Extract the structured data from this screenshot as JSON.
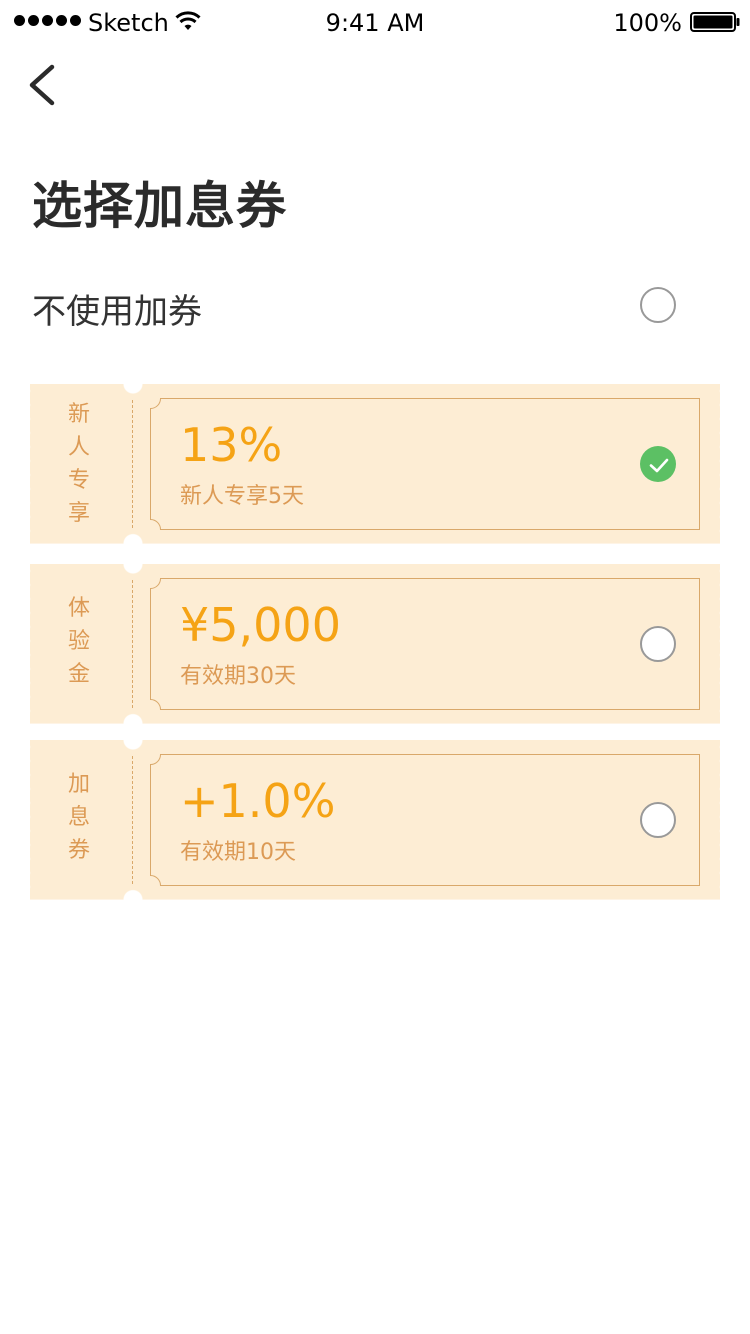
{
  "status_bar": {
    "carrier": "Sketch",
    "time": "9:41 AM",
    "battery": "100%"
  },
  "page": {
    "title": "选择加息券",
    "no_coupon_label": "不使用加券"
  },
  "coupons": [
    {
      "stub": "新人专享",
      "value": "13%",
      "desc": "新人专享5天",
      "selected": true
    },
    {
      "stub": "体验金",
      "value": "¥5,000",
      "desc": "有效期30天",
      "selected": false
    },
    {
      "stub": "加息券",
      "value": "+1.0%",
      "desc": "有效期10天",
      "selected": false
    }
  ],
  "colors": {
    "coupon_bg": "#fdedd4",
    "value": "#f5a315",
    "stub_text": "#dc9a55",
    "check": "#5cc064"
  },
  "icons": {
    "back": "chevron-left-icon",
    "selected": "check-circle-icon"
  }
}
